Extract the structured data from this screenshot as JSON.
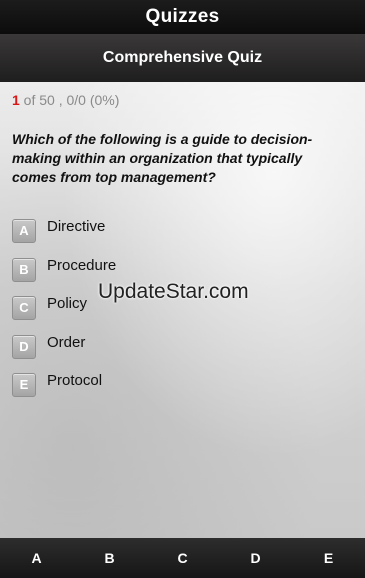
{
  "app_bar": {
    "title": "Quizzes"
  },
  "quiz": {
    "title": "Comprehensive Quiz"
  },
  "progress": {
    "current": "1",
    "total_text": " of 50 , 0/0 (0%)"
  },
  "question": {
    "text": "Which of the following is a guide to decision-making within an organization that typically comes from top management?"
  },
  "options": [
    {
      "letter": "A",
      "label": "Directive"
    },
    {
      "letter": "B",
      "label": "Procedure"
    },
    {
      "letter": "C",
      "label": "Policy"
    },
    {
      "letter": "D",
      "label": "Order"
    },
    {
      "letter": "E",
      "label": "Protocol"
    }
  ],
  "watermark": "UpdateStar.com",
  "answer_bar": [
    "A",
    "B",
    "C",
    "D",
    "E"
  ],
  "colors": {
    "accent_red": "#d81818",
    "bar_dark": "#161616"
  }
}
